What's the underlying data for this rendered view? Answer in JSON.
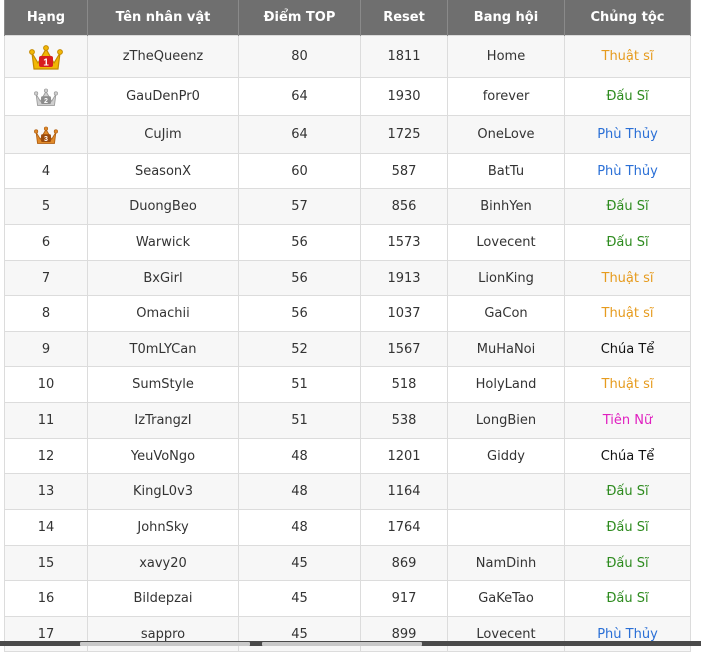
{
  "colors": {
    "header_bg": "#6f6f6f",
    "Thuật sĩ": "#e69b1e",
    "Đấu Sĩ": "#2e8b1f",
    "Phù Thủy": "#2a6fd6",
    "Chúa Tể": "#111111",
    "Tiên Nữ": "#e020c0"
  },
  "table": {
    "headers": {
      "rank": "Hạng",
      "name": "Tên nhân vật",
      "points": "Điểm TOP",
      "reset": "Reset",
      "guild": "Bang hội",
      "class": "Chủng tộc"
    },
    "rows": [
      {
        "rank": "1",
        "medal": "gold-crown-icon",
        "name": "zTheQueenz",
        "points": "80",
        "reset": "1811",
        "guild": "Home",
        "class": "Thuật sĩ"
      },
      {
        "rank": "2",
        "medal": "silver-crown-icon",
        "name": "GauDenPr0",
        "points": "64",
        "reset": "1930",
        "guild": "forever",
        "class": "Đấu Sĩ"
      },
      {
        "rank": "3",
        "medal": "bronze-crown-icon",
        "name": "CuJim",
        "points": "64",
        "reset": "1725",
        "guild": "OneLove",
        "class": "Phù Thủy"
      },
      {
        "rank": "4",
        "name": "SeasonX",
        "points": "60",
        "reset": "587",
        "guild": "BatTu",
        "class": "Phù Thủy"
      },
      {
        "rank": "5",
        "name": "DuongBeo",
        "points": "57",
        "reset": "856",
        "guild": "BinhYen",
        "class": "Đấu Sĩ"
      },
      {
        "rank": "6",
        "name": "Warwick",
        "points": "56",
        "reset": "1573",
        "guild": "Lovecent",
        "class": "Đấu Sĩ"
      },
      {
        "rank": "7",
        "name": "BxGirl",
        "points": "56",
        "reset": "1913",
        "guild": "LionKing",
        "class": "Thuật sĩ"
      },
      {
        "rank": "8",
        "name": "Omachii",
        "points": "56",
        "reset": "1037",
        "guild": "GaCon",
        "class": "Thuật sĩ"
      },
      {
        "rank": "9",
        "name": "T0mLYCan",
        "points": "52",
        "reset": "1567",
        "guild": "MuHaNoi",
        "class": "Chúa Tể"
      },
      {
        "rank": "10",
        "name": "SumStyle",
        "points": "51",
        "reset": "518",
        "guild": "HolyLand",
        "class": "Thuật sĩ"
      },
      {
        "rank": "11",
        "name": "IzTrangzI",
        "points": "51",
        "reset": "538",
        "guild": "LongBien",
        "class": "Tiên Nữ"
      },
      {
        "rank": "12",
        "name": "YeuVoNgo",
        "points": "48",
        "reset": "1201",
        "guild": "Giddy",
        "class": "Chúa Tể"
      },
      {
        "rank": "13",
        "name": "KingL0v3",
        "points": "48",
        "reset": "1164",
        "guild": "",
        "class": "Đấu Sĩ"
      },
      {
        "rank": "14",
        "name": "JohnSky",
        "points": "48",
        "reset": "1764",
        "guild": "",
        "class": "Đấu Sĩ"
      },
      {
        "rank": "15",
        "name": "xavy20",
        "points": "45",
        "reset": "869",
        "guild": "NamDinh",
        "class": "Đấu Sĩ"
      },
      {
        "rank": "16",
        "name": "Bildepzai",
        "points": "45",
        "reset": "917",
        "guild": "GaKeTao",
        "class": "Đấu Sĩ"
      },
      {
        "rank": "17",
        "name": "sappro",
        "points": "45",
        "reset": "899",
        "guild": "Lovecent",
        "class": "Phù Thủy"
      }
    ]
  }
}
